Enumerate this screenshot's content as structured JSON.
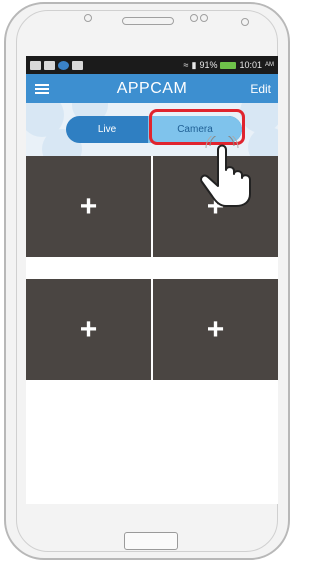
{
  "status_bar": {
    "battery_percent": "91%",
    "time": "10:01",
    "meridiem": "AM"
  },
  "app_bar": {
    "title": "APPCAM",
    "edit_label": "Edit"
  },
  "segment": {
    "live_label": "Live",
    "camera_label": "Camera",
    "selected": "Camera"
  },
  "camera_slots": [
    {
      "label": "+"
    },
    {
      "label": "+"
    },
    {
      "label": "+"
    },
    {
      "label": "+"
    }
  ],
  "colors": {
    "accent": "#3d8fd0",
    "highlight": "#e0242e",
    "slot": "#4a4542"
  }
}
